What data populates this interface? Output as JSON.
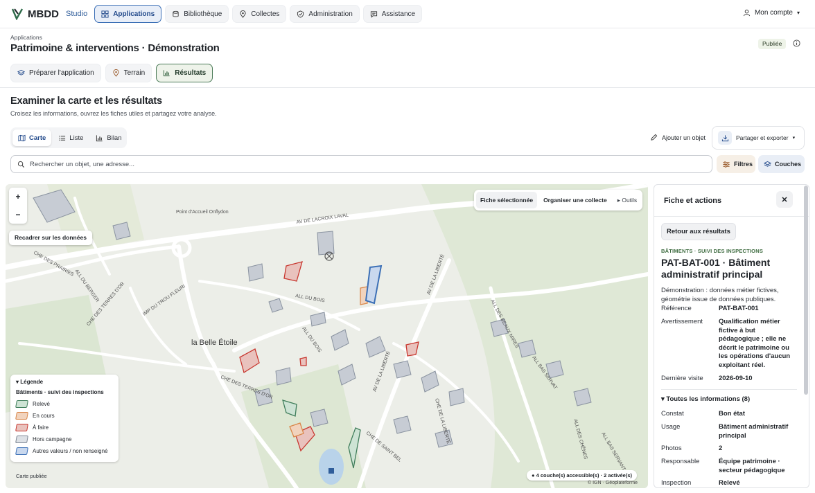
{
  "app": {
    "brand": "MBDD",
    "studio": "Studio",
    "account": "Mon compte"
  },
  "nav": [
    {
      "label": "Applications",
      "icon": "grid-icon",
      "active": true
    },
    {
      "label": "Bibliothèque",
      "icon": "database-icon"
    },
    {
      "label": "Collectes",
      "icon": "pin-icon"
    },
    {
      "label": "Administration",
      "icon": "shield-icon"
    },
    {
      "label": "Assistance",
      "icon": "chat-icon"
    }
  ],
  "header": {
    "breadcrumb": "Applications",
    "title": "Patrimoine & interventions · Démonstration",
    "status": "Publiée"
  },
  "steps": [
    {
      "label": "Préparer l'application",
      "icon": "layers-icon"
    },
    {
      "label": "Terrain",
      "icon": "pin-icon"
    },
    {
      "label": "Résultats",
      "icon": "chart-icon",
      "active": true
    }
  ],
  "section": {
    "title": "Examiner la carte et les résultats",
    "subtitle": "Croisez les informations, ouvrez les fiches utiles et partagez votre analyse."
  },
  "view_tabs": [
    {
      "label": "Carte",
      "active": true
    },
    {
      "label": "Liste"
    },
    {
      "label": "Bilan"
    }
  ],
  "actions": {
    "add_object": "Ajouter un objet",
    "share_export": "Partager et exporter",
    "filters": "Filtres",
    "layers": "Couches"
  },
  "search": {
    "placeholder": "Rechercher un objet, une adresse..."
  },
  "map": {
    "zoom_in": "+",
    "zoom_out": "−",
    "recenter": "Recadrer sur les données",
    "tabs": [
      "Fiche sélectionnée",
      "Organiser une collecte",
      "▸ Outils"
    ],
    "place_labels": [
      "Point d'Accueil Onflydon",
      "AV DE LACROIX LAVAL",
      "CHE DES PRAIRIES",
      "ALL DU BERGER",
      "ALL DU BOIS",
      "AV DE LA LIBERTÉ",
      "CHE DES TERRES D'OR",
      "IMP DU TROU FLEURI",
      "la Belle Étoile",
      "ALL DU BOIS",
      "ALL DES BEAUX MIRES",
      "CHE DES TERRES D'OR",
      "AV DE LA LIBERTÉ",
      "CHE DE LA LIBERTÉ",
      "CHE DE SAINT BEL",
      "ALL DES CHÊNES",
      "ALL BAS SERVAT",
      "ALL BAS SERVANT"
    ],
    "legend": {
      "title": "▾ Légende",
      "subtitle": "Bâtiments · suivi des inspections",
      "items": [
        {
          "label": "Relevé",
          "color": "#3f7d5a"
        },
        {
          "label": "En cours",
          "color": "#d9874a"
        },
        {
          "label": "À faire",
          "color": "#c8372f"
        },
        {
          "label": "Hors campagne",
          "color": "#7c8593"
        },
        {
          "label": "Autres valeurs / non renseigné",
          "color": "#3b6fb6"
        }
      ]
    },
    "footer": "Carte publiée",
    "layers_status": "4 couche(s) accessible(s) · 2 activée(s)",
    "attribution": "© IGN · Géoplateforme"
  },
  "panel": {
    "title": "Fiche et actions",
    "back": "Retour aux résultats",
    "kicker": "BÂTIMENTS · SUIVI DES INSPECTIONS",
    "object_title": "PAT-BAT-001 · Bâtiment administratif principal",
    "demo_note": "Démonstration : données métier fictives, géométrie issue de données publiques.",
    "fields": [
      {
        "k": "Référence",
        "v": "PAT-BAT-001"
      },
      {
        "k": "Avertissement",
        "v": "Qualification métier fictive à but pédagogique ; elle ne décrit le patrimoine ou les opérations d'aucun exploitant réel."
      },
      {
        "k": "Dernière visite",
        "v": "2026-09-10"
      }
    ],
    "all_info": "▾ Toutes les informations (8)",
    "details": [
      {
        "k": "Constat",
        "v": "Bon état"
      },
      {
        "k": "Usage",
        "v": "Bâtiment administratif principal"
      },
      {
        "k": "Photos",
        "v": "2"
      },
      {
        "k": "Responsable",
        "v": "Équipe patrimoine · secteur pédagogique"
      },
      {
        "k": "Inspection",
        "v": "Relevé"
      }
    ]
  }
}
